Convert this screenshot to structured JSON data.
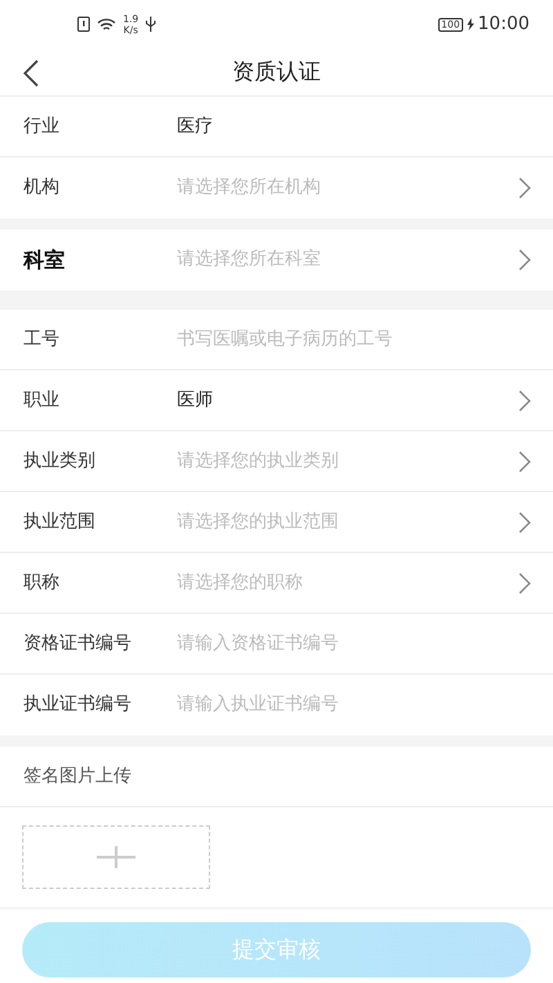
{
  "status_bar": {
    "speed": "1.9",
    "speed_unit": "K/s",
    "battery": "100",
    "time": "10:00"
  },
  "header": {
    "title": "资质认证"
  },
  "sections": [
    {
      "rows": [
        {
          "label": "行业",
          "value": "医疗",
          "arrow": false,
          "emphasis": false
        },
        {
          "label": "机构",
          "placeholder": "请选择您所在机构",
          "arrow": true,
          "emphasis": false
        }
      ]
    },
    {
      "rows": [
        {
          "label": "科室",
          "placeholder": "请选择您所在科室",
          "arrow": true,
          "emphasis": true
        }
      ]
    },
    {
      "rows": [
        {
          "label": "工号",
          "placeholder": "书写医嘱或电子病历的工号",
          "arrow": false,
          "emphasis": false
        },
        {
          "label": "职业",
          "value": "医师",
          "arrow": true,
          "emphasis": false
        },
        {
          "label": "执业类别",
          "placeholder": "请选择您的执业类别",
          "arrow": true,
          "emphasis": false
        },
        {
          "label": "执业范围",
          "placeholder": "请选择您的执业范围",
          "arrow": true,
          "emphasis": false
        },
        {
          "label": "职称",
          "placeholder": "请选择您的职称",
          "arrow": true,
          "emphasis": false
        },
        {
          "label": "资格证书编号",
          "placeholder": "请输入资格证书编号",
          "arrow": false,
          "emphasis": false
        },
        {
          "label": "执业证书编号",
          "placeholder": "请输入执业证书编号",
          "arrow": false,
          "emphasis": false
        }
      ]
    }
  ],
  "upload": {
    "title": "签名图片上传"
  },
  "submit": {
    "label": "提交审核",
    "disabled": true
  }
}
